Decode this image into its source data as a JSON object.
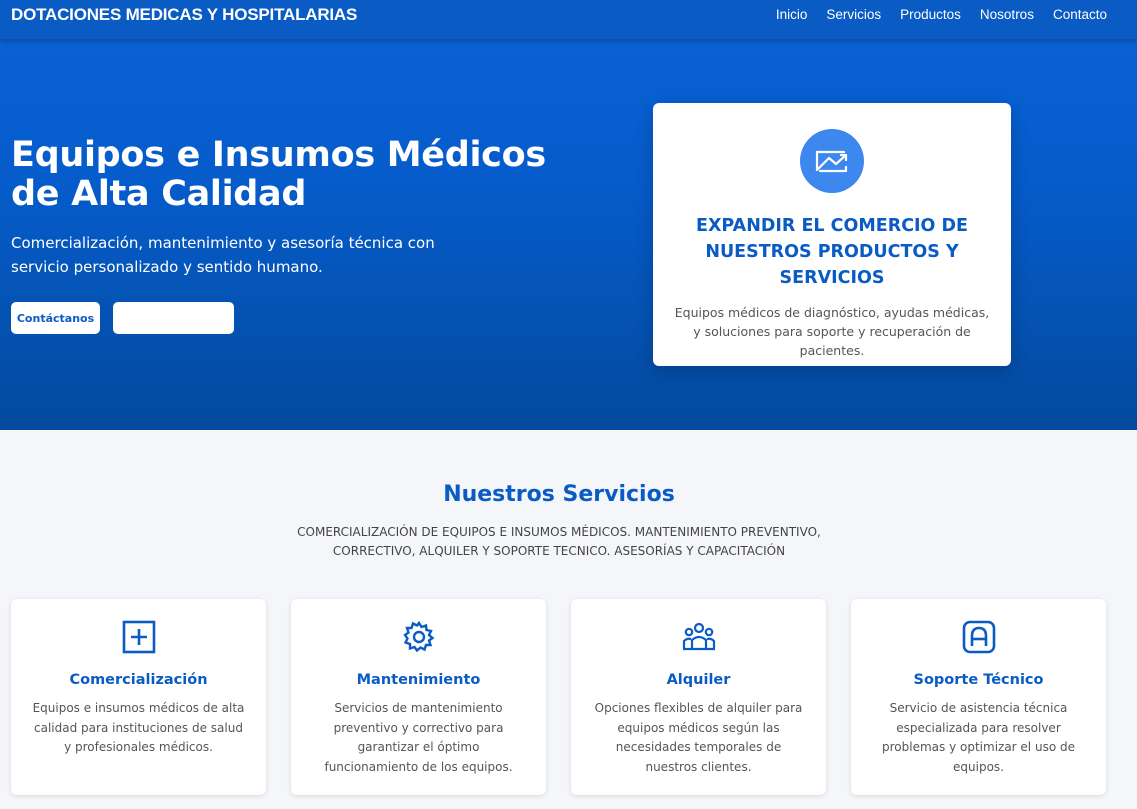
{
  "nav": {
    "brand": "DOTACIONES MEDICAS Y HOSPITALARIAS",
    "links": [
      "Inicio",
      "Servicios",
      "Productos",
      "Nosotros",
      "Contacto"
    ]
  },
  "hero": {
    "title": "Equipos e Insumos Médicos de Alta Calidad",
    "subtitle": "Comercialización, mantenimiento y asesoría técnica con servicio personalizado y sentido humano.",
    "primary_button": "Contáctanos",
    "secondary_button": ""
  },
  "hero_card": {
    "icon": "chart-icon",
    "title": "EXPANDIR EL COMERCIO DE NUESTROS PRODUCTOS Y SERVICIOS",
    "text": "Equipos médicos de diagnóstico, ayudas médicas, y soluciones para soporte y recuperación de pacientes."
  },
  "services": {
    "title": "Nuestros Servicios",
    "subtitle": "COMERCIALIZACIÓN DE EQUIPOS E INSUMOS MÉDICOS. MANTENIMIENTO PREVENTIVO, CORRECTIVO, ALQUILER Y SOPORTE TECNICO. ASESORÍAS Y CAPACITACIÓN",
    "cards": [
      {
        "icon": "medical-plus-icon",
        "title": "Comercialización",
        "text": "Equipos e insumos médicos de alta calidad para instituciones de salud y profesionales médicos."
      },
      {
        "icon": "gear-icon",
        "title": "Mantenimiento",
        "text": "Servicios de mantenimiento preventivo y correctivo para garantizar el óptimo funcionamiento de los equipos."
      },
      {
        "icon": "people-group-icon",
        "title": "Alquiler",
        "text": "Opciones flexibles de alquiler para equipos médicos según las necesidades temporales de nuestros clientes."
      },
      {
        "icon": "support-badge-icon",
        "title": "Soporte Técnico",
        "text": "Servicio de asistencia técnica especializada para resolver problemas y optimizar el uso de equipos."
      }
    ]
  },
  "colors": {
    "primary": "#0a5bc4",
    "accent_circle": "#3d88ee",
    "page_bg": "#f4f6f9"
  }
}
